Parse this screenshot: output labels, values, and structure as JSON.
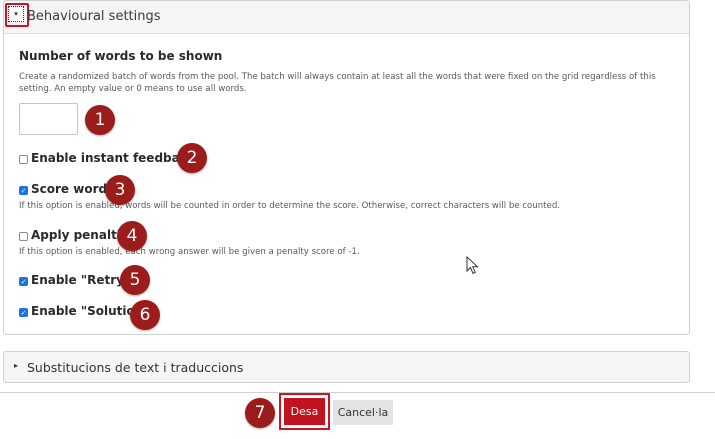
{
  "behavioural": {
    "title": "Behavioural settings",
    "toggle_icon": "▾"
  },
  "words": {
    "label": "Number of words to be shown",
    "description_line1": "Create a randomized batch of words from the pool. The batch will always contain at least all the words that were fixed on the grid regardless of this",
    "description_line2": "setting. An empty value or 0 means to use all words.",
    "value": ""
  },
  "options": {
    "instant_feedback": {
      "label": "Enable instant feedback",
      "checked": false
    },
    "score_words": {
      "label": "Score words",
      "checked": true,
      "description": "If this option is enabled, words will be counted in order to determine the score. Otherwise, correct characters will be counted."
    },
    "apply_penalties": {
      "label": "Apply penalties",
      "checked": false,
      "description": "If this option is enabled, each wrong answer will be given a penalty score of -1."
    },
    "retry": {
      "label": "Enable \"Retry\"",
      "checked": true
    },
    "solution": {
      "label": "Enable \"Solution\"",
      "checked": true
    }
  },
  "badges": [
    "1",
    "2",
    "3",
    "4",
    "5",
    "6",
    "7"
  ],
  "translations": {
    "label": "Substitucions de text i traduccions",
    "caret_icon": "▸"
  },
  "footer": {
    "save_label": "Desa",
    "cancel_label": "Cancel·la"
  },
  "colors": {
    "accent_red": "#c1121f",
    "badge_red": "#9c1b1b",
    "checkbox_blue": "#1a73e8"
  }
}
